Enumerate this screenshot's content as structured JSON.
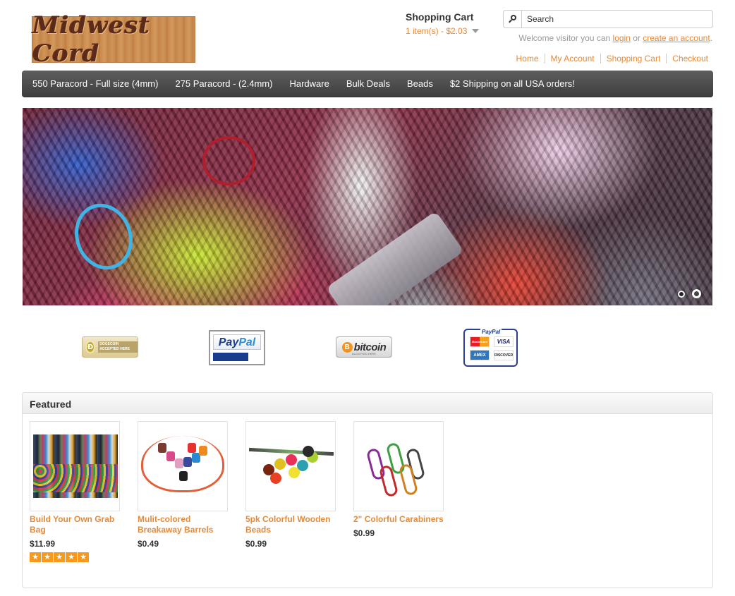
{
  "header": {
    "logo_text": "Midwest Cord",
    "cart_title": "Shopping Cart",
    "cart_summary": "1 item(s) - $2.03",
    "search_placeholder": "Search",
    "welcome_prefix": "Welcome visitor you can",
    "login_label": "login",
    "or_text": "or",
    "create_account_label": "create an account",
    "period": ".",
    "top_links": [
      "Home",
      "My Account",
      "Shopping Cart",
      "Checkout"
    ]
  },
  "menu": {
    "items": [
      "550 Paracord - Full size (4mm)",
      "275 Paracord - (2.4mm)",
      "Hardware",
      "Bulk Deals",
      "Beads",
      "$2 Shipping on all USA orders!"
    ]
  },
  "slideshow": {
    "slide_count": 2,
    "active_slide": 2
  },
  "payments": {
    "dogecoin": {
      "symbol": "Ð",
      "text": "DOGECOIN ACCEPTED HERE"
    },
    "paypal": {
      "word_a": "Pay",
      "word_b": "Pal"
    },
    "bitcoin": {
      "symbol": "B",
      "word": "bitcoin",
      "sub": "ACCEPTED HERE"
    },
    "cards": {
      "header": "PayPal",
      "labels": [
        "MasterCard",
        "VISA",
        "AMEX",
        "DISCOVER"
      ]
    }
  },
  "featured": {
    "title": "Featured",
    "products": [
      {
        "name": "Build Your Own Grab Bag",
        "price": "$11.99",
        "rating": 5
      },
      {
        "name": "Mulit-colored Breakaway Barrels",
        "price": "$0.49"
      },
      {
        "name": "5pk Colorful Wooden Beads",
        "price": "$0.99"
      },
      {
        "name": "2\" Colorful Carabiners",
        "price": "$0.99"
      }
    ]
  },
  "colors": {
    "accent": "#e48a3a",
    "menu_bg": "#4a4a4a",
    "star": "#f8981d"
  }
}
